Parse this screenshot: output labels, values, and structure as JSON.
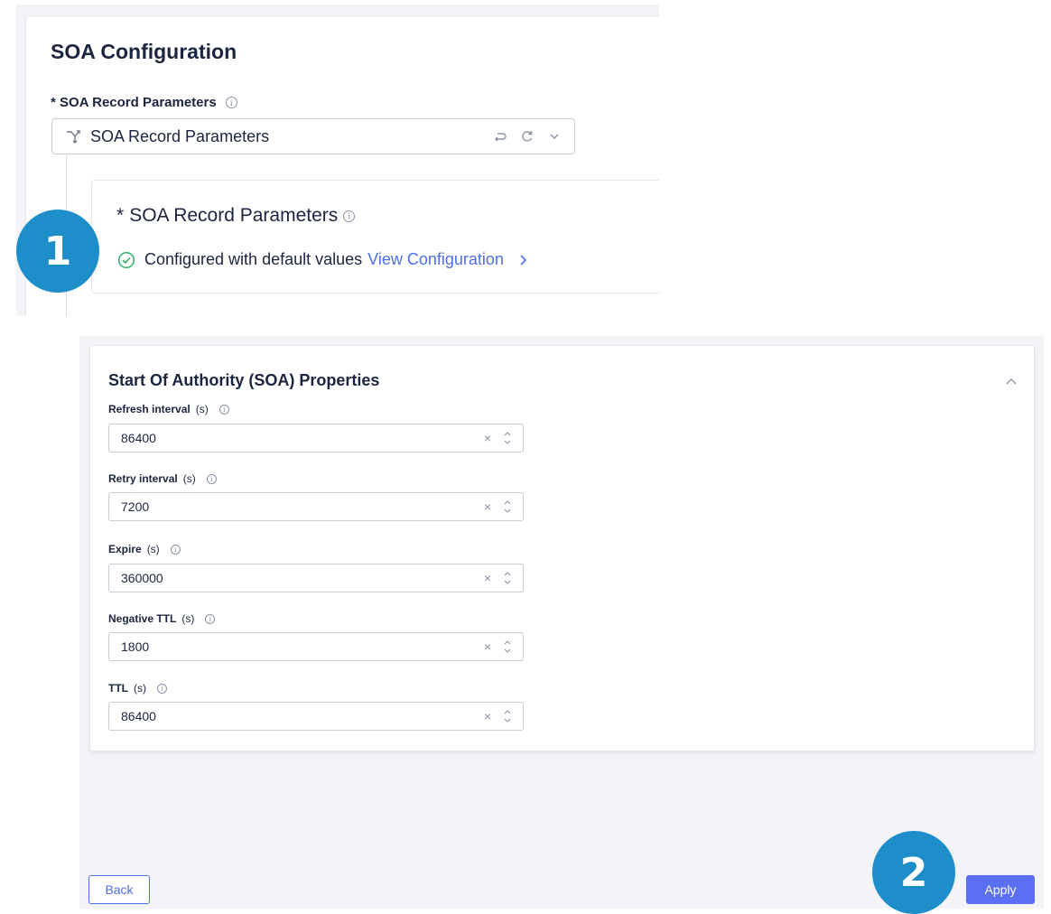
{
  "soa_config": {
    "title": "SOA Configuration",
    "field_label": "SOA Record Parameters",
    "required_mark": "*",
    "select_value": "SOA Record Parameters",
    "inner": {
      "title": "SOA Record Parameters",
      "required_mark": "*",
      "status_text": "Configured with default values",
      "link_text": "View Configuration"
    }
  },
  "badges": {
    "first": "1",
    "second": "2"
  },
  "properties": {
    "title": "Start Of Authority (SOA) Properties",
    "fields": [
      {
        "label": "Refresh interval",
        "unit": "(s)",
        "value": "86400"
      },
      {
        "label": "Retry interval",
        "unit": "(s)",
        "value": "7200"
      },
      {
        "label": "Expire",
        "unit": "(s)",
        "value": "360000"
      },
      {
        "label": "Negative TTL",
        "unit": "(s)",
        "value": "1800"
      },
      {
        "label": "TTL",
        "unit": "(s)",
        "value": "86400"
      }
    ]
  },
  "buttons": {
    "back": "Back",
    "apply": "Apply"
  },
  "colors": {
    "accent": "#4f6fe8",
    "badge": "#1e8ecb",
    "success": "#2fb36a",
    "primary_button": "#5b6ff5"
  },
  "icons": {
    "info": "info-icon",
    "branch": "branch-icon",
    "reset": "reset-icon",
    "refresh": "refresh-icon",
    "dropdown": "chevron-down-icon",
    "check": "check-circle-icon",
    "link_arrow": "chevron-right-icon",
    "collapse": "chevron-up-icon",
    "clear": "clear-icon",
    "stepper": "stepper-icon"
  }
}
